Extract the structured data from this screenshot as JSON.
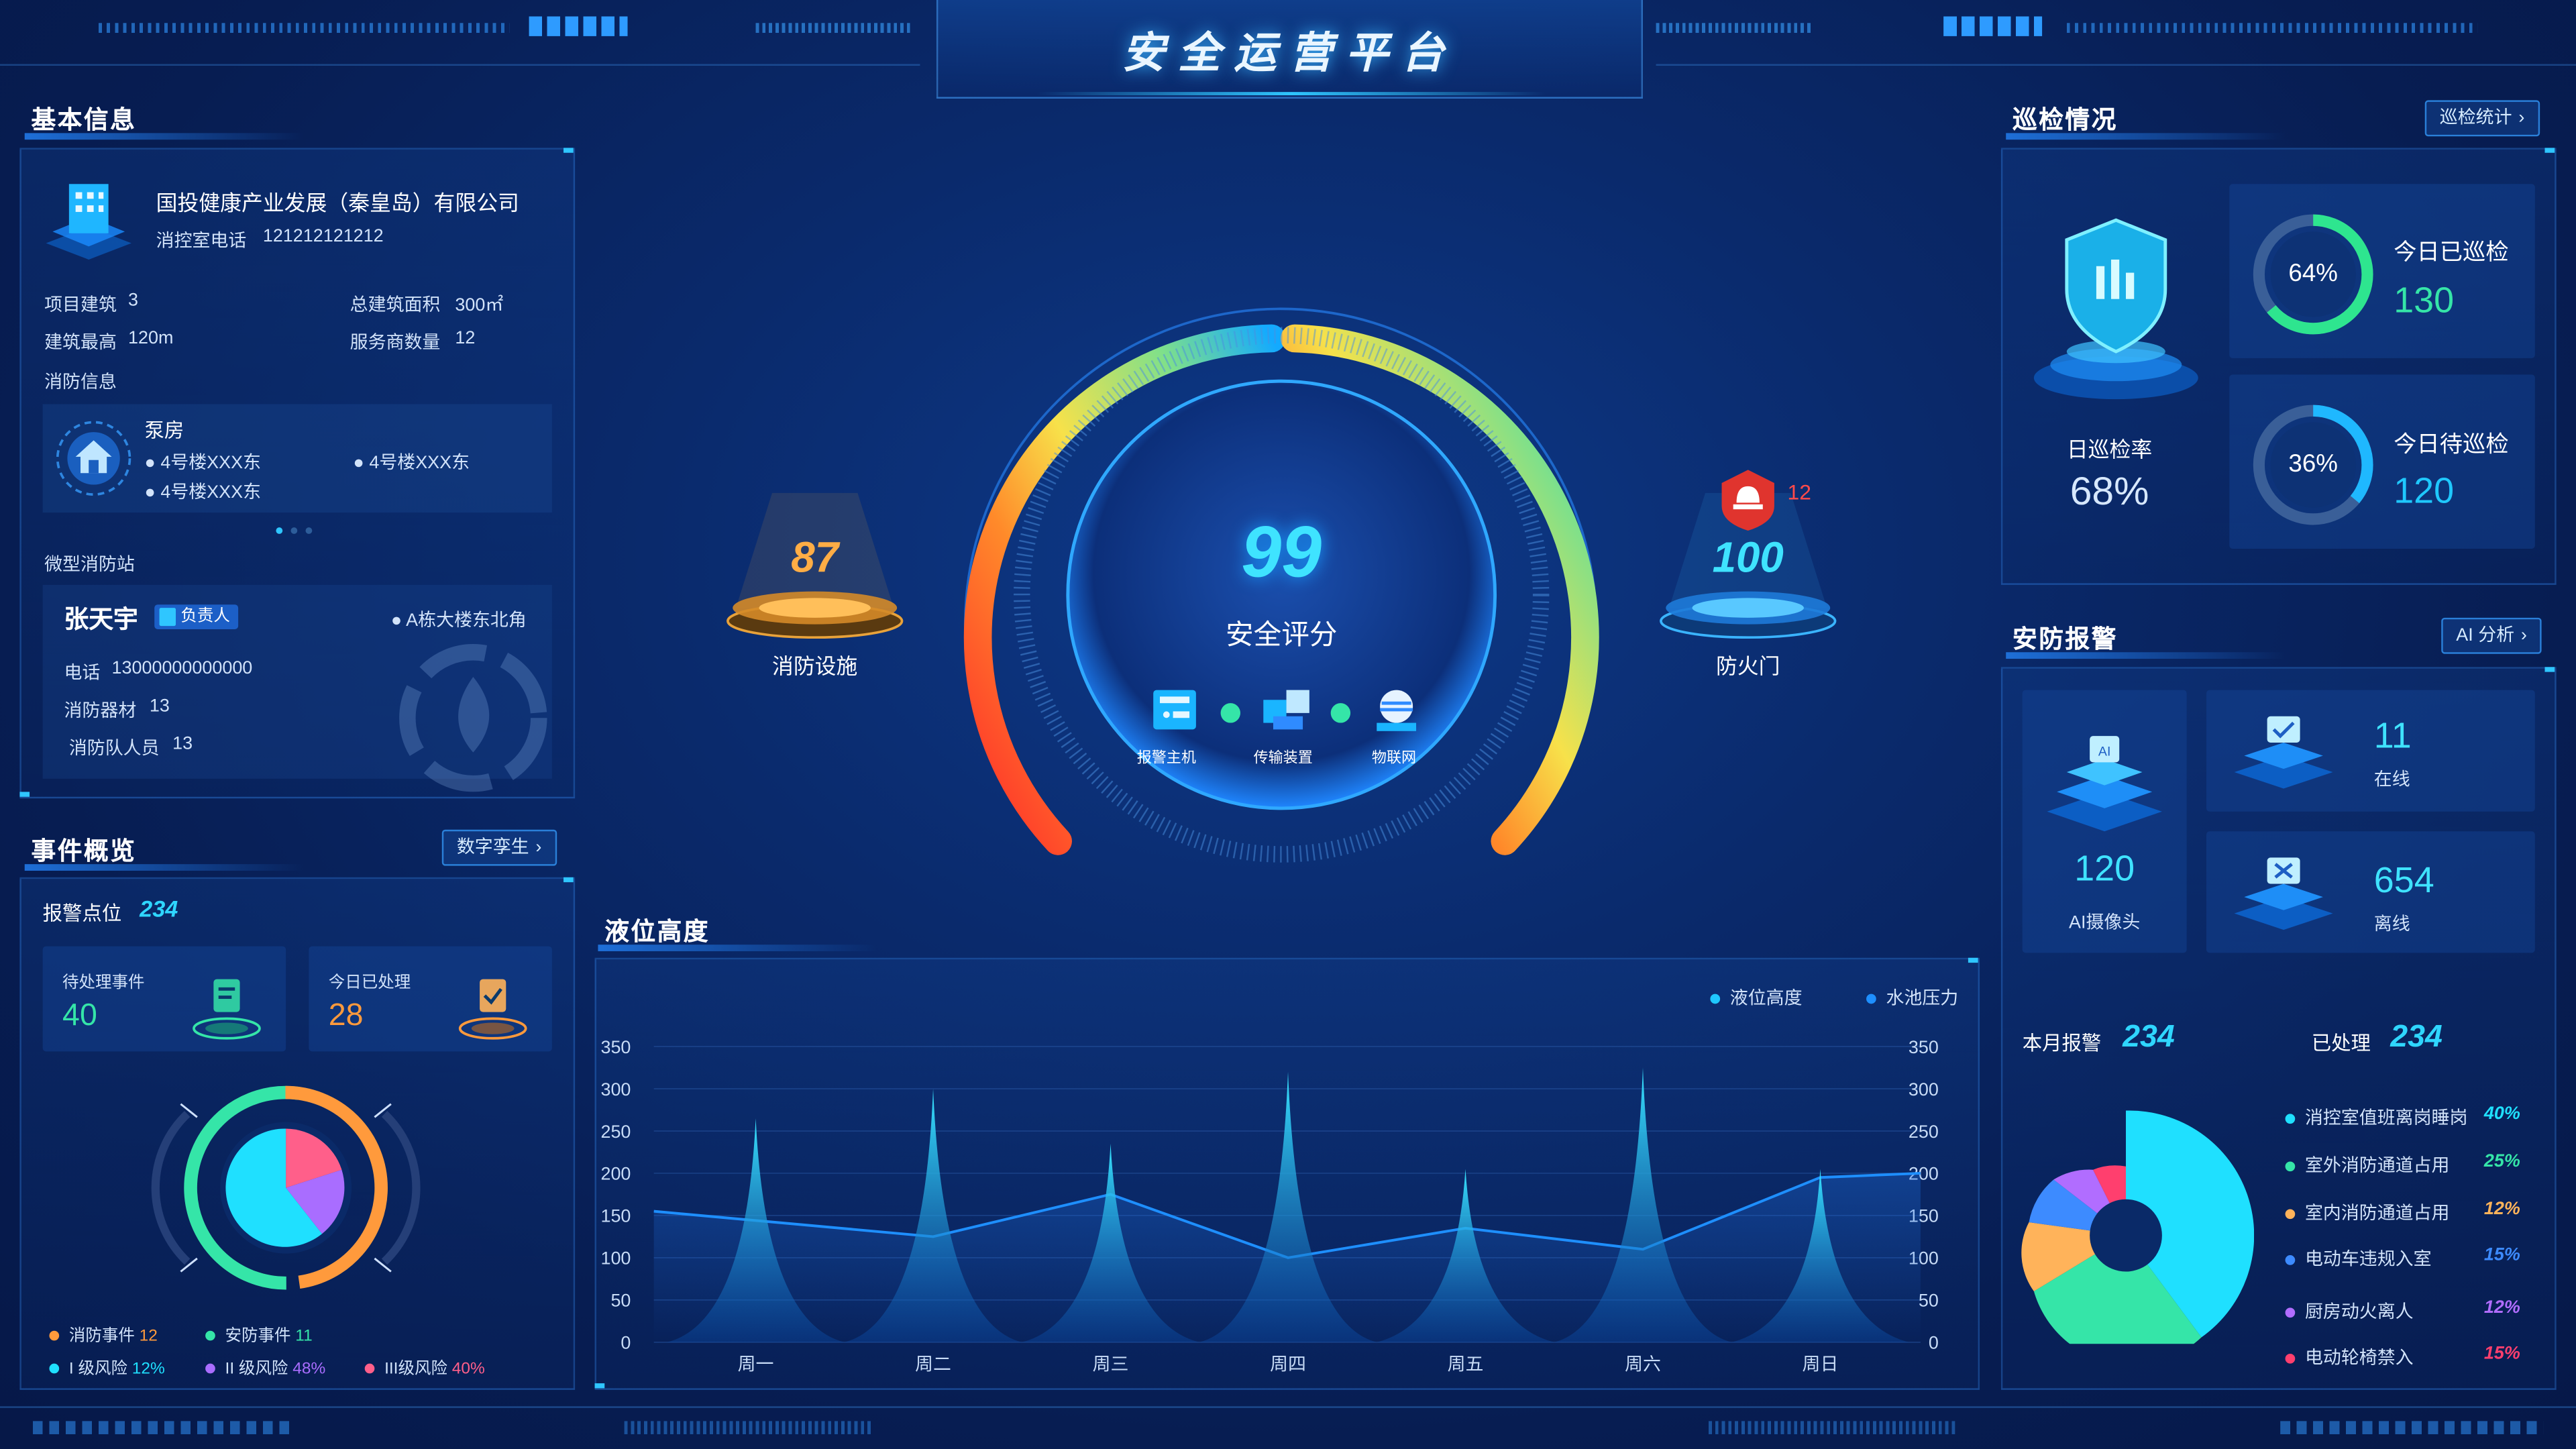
{
  "header": {
    "title": "安全运营平台"
  },
  "basic_info": {
    "section_title": "基本信息",
    "company_name": "国投健康产业发展（秦皇岛）有限公司",
    "phone_label": "消控室电话",
    "phone": "121212121212",
    "project_label": "项目建筑",
    "project_value": "3",
    "area_label": "总建筑面积",
    "area_value": "300㎡",
    "height_label": "建筑最高",
    "height_value": "120m",
    "service_label": "服务商数量",
    "service_value": "12",
    "fire_info_label": "消防信息",
    "pump_title": "泵房",
    "pump_locations": [
      "4号楼XXX东",
      "4号楼XXX东",
      "4号楼XXX东"
    ],
    "micro_station_label": "微型消防站",
    "person_name": "张天宇",
    "person_role": "负责人",
    "person_location": "A栋大楼东北角",
    "tel_label": "电话",
    "tel_value": "13000000000000",
    "equip_label": "消防器材",
    "equip_value": "13",
    "team_label": "消防队人员",
    "team_value": "13"
  },
  "events": {
    "section_title": "事件概览",
    "button": "数字孪生",
    "alarm_points_label": "报警点位",
    "alarm_points_value": "234",
    "pending_label": "待处理事件",
    "pending_value": "40",
    "handled_label": "今日已处理",
    "handled_value": "28",
    "legend": [
      {
        "label": "消防事件",
        "value": "12",
        "color": "#ff9a3c"
      },
      {
        "label": "安防事件",
        "value": "11",
        "color": "#35e5a8"
      },
      {
        "label": "I 级风险",
        "value": "12%",
        "color": "#1fe0ff"
      },
      {
        "label": "II 级风险",
        "value": "48%",
        "color": "#a96dff"
      },
      {
        "label": "III级风险",
        "value": "40%",
        "color": "#ff5f8a"
      }
    ]
  },
  "center": {
    "score": "99",
    "score_label": "安全评分",
    "left_value": "87",
    "left_label": "消防设施",
    "right_value": "100",
    "right_label": "防火门",
    "right_badge": "12",
    "chain": [
      "报警主机",
      "传输装置",
      "物联网"
    ]
  },
  "liquid": {
    "section_title": "液位高度",
    "legend": [
      "液位高度",
      "水池压力"
    ]
  },
  "chart_data": {
    "type": "area",
    "title": "液位高度",
    "categories": [
      "周一",
      "周二",
      "周三",
      "周四",
      "周五",
      "周六",
      "周日"
    ],
    "ylim": [
      0,
      350
    ],
    "yticks": [
      0,
      50,
      100,
      150,
      200,
      250,
      300,
      350
    ],
    "y2ticks": [
      0,
      50,
      100,
      150,
      200,
      250,
      300,
      350
    ],
    "series": [
      {
        "name": "液位高度",
        "type": "area",
        "values": [
          265,
          300,
          235,
          320,
          205,
          325,
          205
        ],
        "color": "#1fc8ff"
      },
      {
        "name": "水池压力",
        "type": "line",
        "values": [
          155,
          125,
          175,
          100,
          135,
          110,
          195
        ],
        "color": "#1e8fff"
      }
    ]
  },
  "patrol": {
    "section_title": "巡检情况",
    "button": "巡检统计",
    "rate_label": "日巡检率",
    "rate_value": "68%",
    "done_pct": "64%",
    "done_fraction": 0.64,
    "done_label": "今日已巡检",
    "done_value": "130",
    "todo_pct": "36%",
    "todo_fraction": 0.36,
    "todo_label": "今日待巡检",
    "todo_value": "120"
  },
  "security": {
    "section_title": "安防报警",
    "button": "AI 分析",
    "ai_value": "120",
    "ai_label": "AI摄像头",
    "online_value": "11",
    "online_label": "在线",
    "offline_value": "654",
    "offline_label": "离线",
    "month_label": "本月报警",
    "month_value": "234",
    "done_label": "已处理",
    "done_value": "234",
    "items": [
      {
        "label": "消控室值班离岗睡岗",
        "value": "40%",
        "color": "#1fe0ff"
      },
      {
        "label": "室外消防通道占用",
        "value": "25%",
        "color": "#35e5a8"
      },
      {
        "label": "室内消防通道占用",
        "value": "12%",
        "color": "#ffb35a"
      },
      {
        "label": "电动车违规入室",
        "value": "15%",
        "color": "#3d8bff"
      },
      {
        "label": "厨房动火离人",
        "value": "12%",
        "color": "#b16dff"
      },
      {
        "label": "电动轮椅禁入",
        "value": "15%",
        "color": "#ff3f6e"
      }
    ]
  }
}
